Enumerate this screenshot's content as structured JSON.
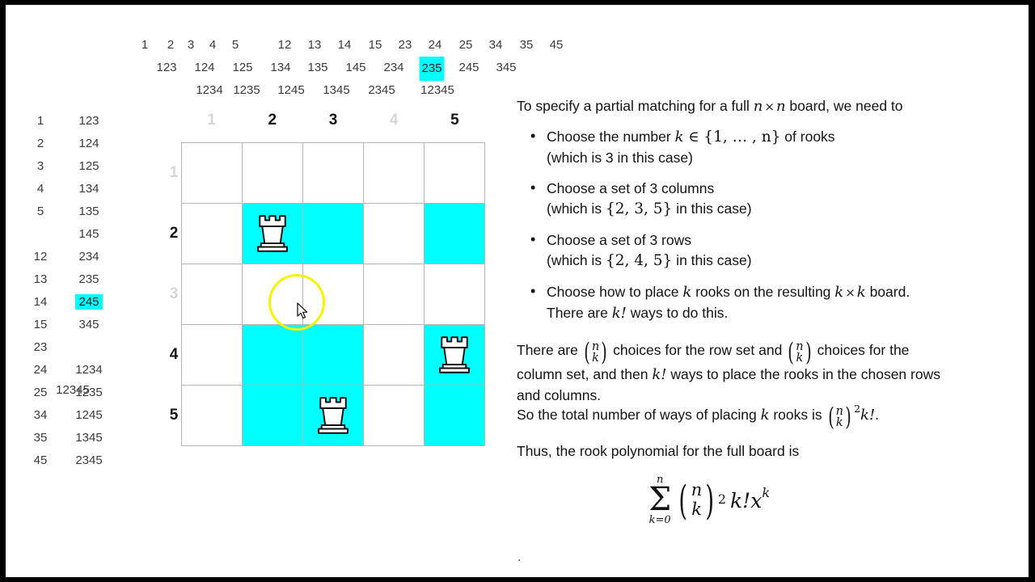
{
  "colors": {
    "highlight": "#00ffff",
    "grid_line": "#b6b6b6",
    "dim_label": "#d6d6d6",
    "text": "#131313",
    "click_ring": "#f3f500",
    "letterbox": "#000000"
  },
  "subset_header": {
    "size1_row": [
      "1",
      "2",
      "3",
      "4",
      "5",
      "12",
      "13",
      "14",
      "15",
      "23",
      "24",
      "25",
      "34",
      "35",
      "45"
    ],
    "size3_row": [
      "123",
      "124",
      "125",
      "134",
      "135",
      "145",
      "234",
      "235",
      "245",
      "345"
    ],
    "size3_highlighted": "235",
    "size4_row": [
      "1234",
      "1235",
      "1245",
      "1345",
      "2345",
      "12345"
    ]
  },
  "left_list": {
    "column_a": [
      "1",
      "2",
      "3",
      "4",
      "5",
      "",
      "12",
      "13",
      "14",
      "15",
      "23",
      "24",
      "25",
      "34",
      "35",
      "45"
    ],
    "column_b": [
      "123",
      "124",
      "125",
      "134",
      "135",
      "145",
      "234",
      "235",
      "245",
      "345",
      "",
      "1234",
      "1235",
      "1245",
      "1345",
      "2345"
    ],
    "column_b_highlighted": "245",
    "full_set": "12345"
  },
  "board": {
    "column_labels": [
      "1",
      "2",
      "3",
      "4",
      "5"
    ],
    "row_labels": [
      "1",
      "2",
      "3",
      "4",
      "5"
    ],
    "active_columns": [
      2,
      3,
      5
    ],
    "active_rows": [
      2,
      4,
      5
    ],
    "rooks": [
      {
        "row": 2,
        "col": 2
      },
      {
        "row": 4,
        "col": 5
      },
      {
        "row": 5,
        "col": 3
      }
    ],
    "cursor_position": {
      "row": 3,
      "col": 3
    }
  },
  "right_panel": {
    "intro": {
      "before": "To specify a partial matching for a full ",
      "math_n1": "n",
      "times": "×",
      "math_n2": "n",
      "after": " board, we need to"
    },
    "bullets": [
      {
        "main_before": "Choose the number ",
        "math_k": "k",
        "math_in": "∈",
        "math_set": "{1, … , n}",
        "main_after": " of rooks",
        "sub": "(which is 3 in this case)"
      },
      {
        "main_before": "Choose a set of 3 columns",
        "sub_before": "(which is ",
        "sub_set": "{2, 3, 5}",
        "sub_after": " in this case)"
      },
      {
        "main_before": "Choose a set of 3 rows",
        "sub_before": "(which is ",
        "sub_set": "{2, 4, 5}",
        "sub_after": " in this case)"
      },
      {
        "main_before": "Choose how to place ",
        "math_k": "k",
        "main_mid": " rooks on the resulting ",
        "math_k2": "k",
        "times": "×",
        "math_k3": "k",
        "main_after": " board.",
        "sub_before": "There are ",
        "sub_math": "k!",
        "sub_after": " ways to do this."
      }
    ],
    "paragraph1": {
      "p1": "There are ",
      "binom1_top": "n",
      "binom1_bot": "k",
      "p2": " choices for the row set and ",
      "binom2_top": "n",
      "binom2_bot": "k",
      "p3": " choices for the",
      "line2_before": "column set, and then ",
      "line2_math": "k!",
      "line2_after": " ways to place the rooks in the chosen rows",
      "line3": "and columns."
    },
    "paragraph2": {
      "before": "So the total number of ways of placing ",
      "math_k": "k",
      "mid": " rooks is ",
      "binom_top": "n",
      "binom_bot": "k",
      "sup": "2",
      "tail": "k!",
      "period": "."
    },
    "paragraph3": "Thus, the rook polynomial for the full board is",
    "final_formula": {
      "sum_upper": "n",
      "sum_symbol": "Σ",
      "sum_lower": "k=0",
      "binom_top": "n",
      "binom_bot": "k",
      "exponent": "2",
      "factorial": "k!",
      "variable": "x",
      "var_exponent": "k"
    },
    "trailing_dot": "."
  }
}
